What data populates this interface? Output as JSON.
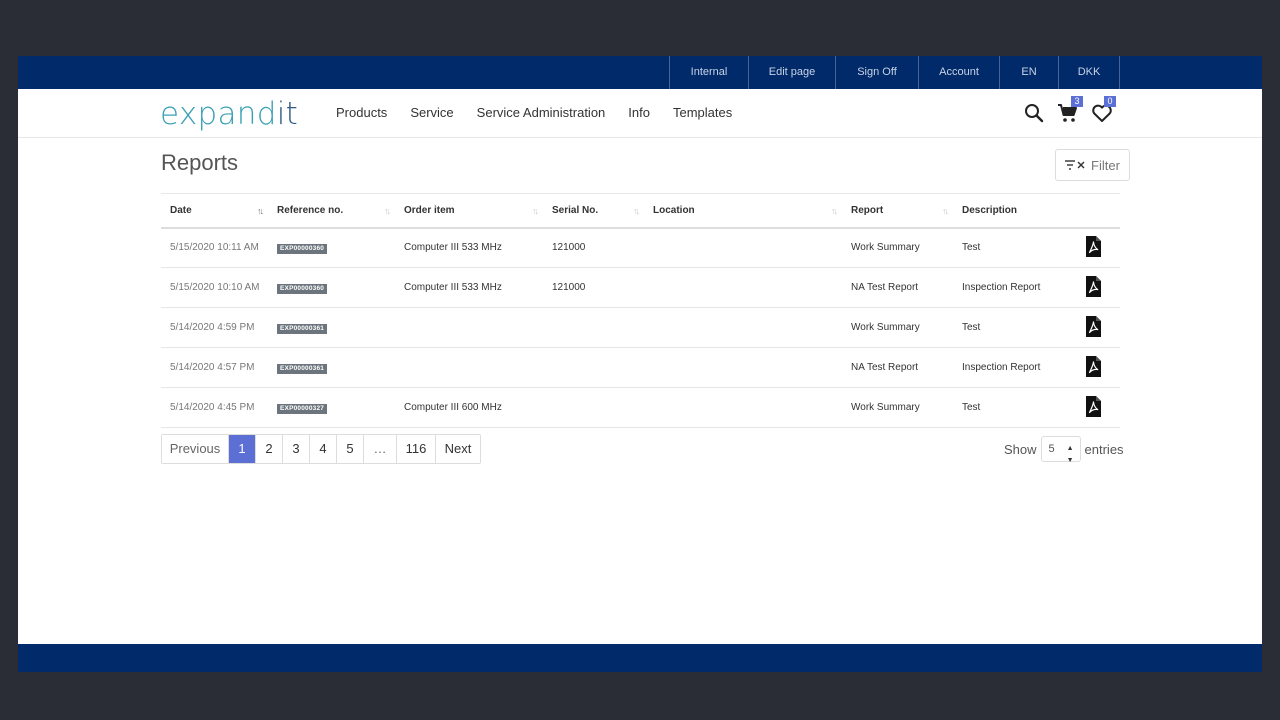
{
  "topbar": {
    "links": [
      "Internal",
      "Edit page",
      "Sign Off",
      "Account",
      "EN",
      "DKK"
    ]
  },
  "header": {
    "logo_main": "expand",
    "logo_accent": "it",
    "nav": [
      "Products",
      "Service",
      "Service Administration",
      "Info",
      "Templates"
    ],
    "cart_count": "3",
    "wishlist_count": "0"
  },
  "page": {
    "title": "Reports",
    "filter_label": "Filter"
  },
  "table": {
    "columns": [
      "Date",
      "Reference no.",
      "Order item",
      "Serial No.",
      "Location",
      "Report",
      "Description"
    ],
    "rows": [
      {
        "date": "5/15/2020 10:11 AM",
        "ref": "EXP00000360",
        "order_item": "Computer III 533 MHz",
        "serial": "121000",
        "location": "",
        "report": "Work Summary",
        "description": "Test"
      },
      {
        "date": "5/15/2020 10:10 AM",
        "ref": "EXP00000360",
        "order_item": "Computer III 533 MHz",
        "serial": "121000",
        "location": "",
        "report": "NA Test Report",
        "description": "Inspection Report"
      },
      {
        "date": "5/14/2020 4:59 PM",
        "ref": "EXP00000361",
        "order_item": "",
        "serial": "",
        "location": "",
        "report": "Work Summary",
        "description": "Test"
      },
      {
        "date": "5/14/2020 4:57 PM",
        "ref": "EXP00000361",
        "order_item": "",
        "serial": "",
        "location": "",
        "report": "NA Test Report",
        "description": "Inspection Report"
      },
      {
        "date": "5/14/2020 4:45 PM",
        "ref": "EXP00000327",
        "order_item": "Computer III 600 MHz",
        "serial": "",
        "location": "",
        "report": "Work Summary",
        "description": "Test"
      }
    ]
  },
  "pagination": {
    "previous": "Previous",
    "pages": [
      "1",
      "2",
      "3",
      "4",
      "5",
      "…",
      "116"
    ],
    "next": "Next",
    "active_page": "1"
  },
  "entries": {
    "show_label": "Show",
    "value": "5",
    "suffix": "entries"
  },
  "colors": {
    "topbar": "#002a6a",
    "accent": "#5b6fd4",
    "logo": "#3aa0b4"
  }
}
